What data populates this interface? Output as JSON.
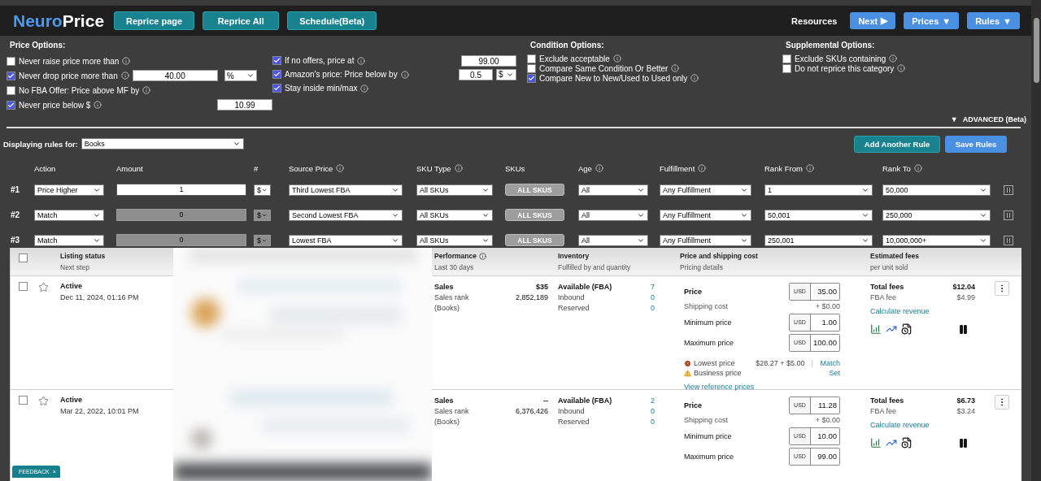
{
  "brand": {
    "first": "Neuro",
    "second": "Price"
  },
  "top_buttons": [
    "Reprice page",
    "Reprice All",
    "Schedule(Beta)"
  ],
  "nav": {
    "resources": "Resources",
    "buttons": [
      {
        "label": "Next",
        "caret": "▶"
      },
      {
        "label": "Prices",
        "caret": "▼"
      },
      {
        "label": "Rules",
        "caret": "▼"
      }
    ]
  },
  "price_options": {
    "title": "Price Options:",
    "left": [
      {
        "label": "Never raise price more than",
        "checked": false
      },
      {
        "label": "Never drop price more than",
        "checked": true,
        "value": "40.00",
        "unit": "%"
      },
      {
        "label": "No FBA Offer: Price above MF by",
        "checked": false
      },
      {
        "label": "Never price below $",
        "checked": true,
        "value": "10.99"
      }
    ],
    "middle": [
      {
        "label": "If no offers, price at",
        "checked": true,
        "value": "99.00"
      },
      {
        "label": "Amazon's price: Price below by",
        "checked": true,
        "value": "0.5",
        "unit": "$"
      },
      {
        "label": "Stay inside min/max",
        "checked": true
      }
    ]
  },
  "condition_options": {
    "title": "Condition Options:",
    "items": [
      {
        "label": "Exclude acceptable",
        "checked": false
      },
      {
        "label": "Compare Same Condition Or Better",
        "checked": false
      },
      {
        "label": "Compare New to New/Used to Used only",
        "checked": true
      }
    ]
  },
  "supplemental_options": {
    "title": "Supplemental Options:",
    "items": [
      {
        "label": "Exclude SKUs containing",
        "checked": false
      },
      {
        "label": "Do not reprice this category",
        "checked": false
      }
    ]
  },
  "advanced": {
    "caret": "▼",
    "label": "ADVANCED (Beta)"
  },
  "rules": {
    "filter_label": "Displaying rules for:",
    "filter_value": "Books",
    "add_button": "Add Another Rule",
    "save_button": "Save Rules",
    "columns": [
      {
        "label": "Action"
      },
      {
        "label": "Amount"
      },
      {
        "label": "#"
      },
      {
        "label": "Source Price",
        "info": true
      },
      {
        "label": "SKU Type",
        "info": true
      },
      {
        "label": "SKUs"
      },
      {
        "label": "Age",
        "info": true
      },
      {
        "label": "Fulfillment",
        "info": true
      },
      {
        "label": "Rank From",
        "info": true
      },
      {
        "label": "Rank To",
        "info": true
      }
    ],
    "rows": [
      {
        "number": "#1",
        "action": "Price Higher",
        "amount": "1",
        "amount_disabled": false,
        "unit": "$",
        "source": "Third Lowest FBA",
        "sku_type": "All SKUs",
        "skus": "ALL SKUS",
        "age": "All",
        "fulfillment": "Any Fulfillment",
        "rank_from": "1",
        "rank_to": "50,000"
      },
      {
        "number": "#2",
        "action": "Match",
        "amount": "0",
        "amount_disabled": true,
        "unit": "$",
        "source": "Second Lowest FBA",
        "sku_type": "All SKUs",
        "skus": "ALL SKUS",
        "age": "All",
        "fulfillment": "Any Fulfillment",
        "rank_from": "50,001",
        "rank_to": "250,000"
      },
      {
        "number": "#3",
        "action": "Match",
        "amount": "0",
        "amount_disabled": true,
        "unit": "$",
        "source": "Lowest FBA",
        "sku_type": "All SKUs",
        "skus": "ALL SKUS",
        "age": "All",
        "fulfillment": "Any Fulfillment",
        "rank_from": "250,001",
        "rank_to": "10,000,000+"
      }
    ]
  },
  "listing": {
    "select_all_checked": false,
    "columns": [
      {
        "title": "Listing status",
        "subtitle": "Next step"
      },
      {
        "title": "Performance",
        "subtitle": "Last 30 days",
        "info": true
      },
      {
        "title": "Inventory",
        "subtitle": "Fulfilled by and quantity"
      },
      {
        "title": "Price and shipping cost",
        "subtitle": "Pricing details"
      },
      {
        "title": "Estimated fees",
        "subtitle": "per unit sold"
      }
    ],
    "rows": [
      {
        "checked": false,
        "starred": false,
        "status": "Active",
        "date": "Dec 11, 2024, 01:16 PM",
        "performance": [
          {
            "label": "Sales",
            "value": "$35"
          },
          {
            "label": "Sales rank",
            "value": "2,852,189"
          },
          {
            "label": "(Books)"
          }
        ],
        "inventory": [
          {
            "label": "Available (FBA)",
            "value": "7"
          },
          {
            "label": "Inbound",
            "value": "0"
          },
          {
            "label": "Reserved",
            "value": "0"
          }
        ],
        "pricing": [
          {
            "kind": "field",
            "label": "Price",
            "currency": "USD",
            "value": "35.00"
          },
          {
            "kind": "text",
            "label": "Shipping cost",
            "value": "+ $0.00"
          },
          {
            "kind": "field",
            "label": "Minimum price",
            "currency": "USD",
            "value": "1.00"
          },
          {
            "kind": "field",
            "label": "Maximum price",
            "currency": "USD",
            "value": "100.00"
          }
        ],
        "alerts": [
          {
            "kind": "error",
            "label": "Lowest price",
            "value": "$28.27 + $5.00",
            "action": "Match"
          },
          {
            "kind": "warning",
            "label": "Business price",
            "action": "Set"
          }
        ],
        "reference_link": "View reference prices",
        "fees": [
          {
            "label": "Total fees",
            "value": "$12.04"
          },
          {
            "label": "FBA fee",
            "value": "$4.99"
          }
        ],
        "fees_link": "Calculate revenue"
      },
      {
        "checked": false,
        "starred": false,
        "status": "Active",
        "date": "Mar 22, 2022, 10:01 PM",
        "performance": [
          {
            "label": "Sales",
            "value": "--"
          },
          {
            "label": "Sales rank",
            "value": "6,376,426"
          },
          {
            "label": "(Books)"
          }
        ],
        "inventory": [
          {
            "label": "Available (FBA)",
            "value": "2"
          },
          {
            "label": "Inbound",
            "value": "0"
          },
          {
            "label": "Reserved",
            "value": "0"
          }
        ],
        "pricing": [
          {
            "kind": "field",
            "label": "Price",
            "currency": "USD",
            "value": "11.28"
          },
          {
            "kind": "text",
            "label": "Shipping cost",
            "value": "+ $0.00"
          },
          {
            "kind": "field",
            "label": "Minimum price",
            "currency": "USD",
            "value": "10.00"
          },
          {
            "kind": "field",
            "label": "Maximum price",
            "currency": "USD",
            "value": "99.00"
          }
        ],
        "fees": [
          {
            "label": "Total fees",
            "value": "$6.73"
          },
          {
            "label": "FBA fee",
            "value": "$3.24"
          }
        ],
        "fees_link": "Calculate revenue"
      }
    ]
  },
  "feedback": {
    "label": "FEEDBACK",
    "close": "×"
  }
}
